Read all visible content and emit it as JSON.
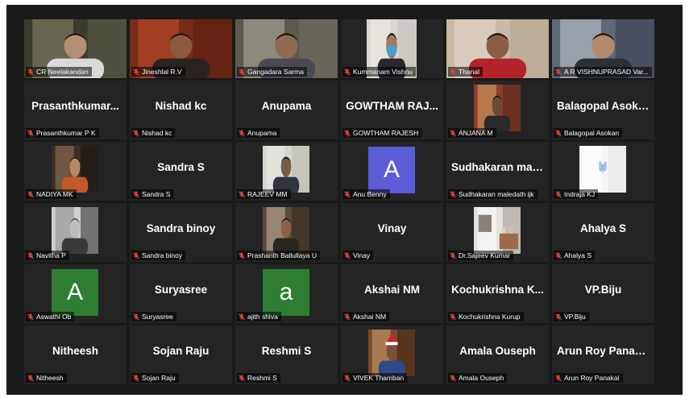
{
  "colors": {
    "background": "#1a1a1a",
    "tile": "#242424",
    "active_border": "#d4e33a",
    "muted": "#e0453c",
    "avatar_purple": "#5b5cd6",
    "avatar_green": "#2e7d32"
  },
  "participants": [
    {
      "label": "CR Neelakandan",
      "type": "video",
      "active": true
    },
    {
      "label": "Jineshlal R.V",
      "type": "video"
    },
    {
      "label": "Gangadara Sarma",
      "type": "video"
    },
    {
      "label": "Kummanam Vishnu",
      "type": "video"
    },
    {
      "label": "Thanal",
      "type": "video"
    },
    {
      "label": "A R VISHNUPRASAD Var...",
      "type": "video"
    },
    {
      "name": "Prasanthkumar...",
      "label": "Prasanthkumar P K",
      "type": "name"
    },
    {
      "name": "Nishad kc",
      "label": "Nishad kc",
      "type": "name"
    },
    {
      "name": "Anupama",
      "label": "Anupama",
      "type": "name"
    },
    {
      "name": "GOWTHAM RAJ...",
      "label": "GOWTHAM RAJESH",
      "type": "name"
    },
    {
      "label": "ANJANA M",
      "type": "photo"
    },
    {
      "name": "Balagopal Asokan",
      "label": "Balagopal Asokan",
      "type": "name"
    },
    {
      "label": "NADIYA MK",
      "type": "photo"
    },
    {
      "name": "Sandra S",
      "label": "Sandra S",
      "type": "name"
    },
    {
      "label": "RAJEEV MM",
      "type": "photo"
    },
    {
      "letter": "A",
      "label": "Anu Benny",
      "type": "avatar",
      "avatar_color": "#5b5cd6"
    },
    {
      "name": "Sudhakaran mal...",
      "label": "Sudhakaran maledath ijk",
      "type": "name"
    },
    {
      "label": "Indraja KJ",
      "type": "photo"
    },
    {
      "label": "Navitha P",
      "type": "photo"
    },
    {
      "name": "Sandra binoy",
      "label": "Sandra binoy",
      "type": "name"
    },
    {
      "label": "Prashanth Ballullaya U",
      "type": "photo"
    },
    {
      "name": "Vinay",
      "label": "Vinay",
      "type": "name"
    },
    {
      "label": "Dr.Sajeev Kumar",
      "type": "photo"
    },
    {
      "name": "Ahalya S",
      "label": "Ahalya S",
      "type": "name"
    },
    {
      "letter": "A",
      "label": "Aswathi Ob",
      "type": "avatar",
      "avatar_color": "#2e7d32"
    },
    {
      "name": "Suryasree",
      "label": "Suryasree",
      "type": "name"
    },
    {
      "letter": "a",
      "label": "ajith shiva",
      "type": "avatar",
      "avatar_color": "#2e7d32"
    },
    {
      "name": "Akshai NM",
      "label": "Akshai NM",
      "type": "name"
    },
    {
      "name": "Kochukrishna K...",
      "label": "Kochukrishna Kurup",
      "type": "name"
    },
    {
      "name": "VP.Biju",
      "label": "VP.Biju",
      "type": "name"
    },
    {
      "name": "Nitheesh",
      "label": "Nitheesh",
      "type": "name"
    },
    {
      "name": "Sojan Raju",
      "label": "Sojan Raju",
      "type": "name"
    },
    {
      "name": "Reshmi S",
      "label": "Reshmi S",
      "type": "name"
    },
    {
      "label": "VIVEK Thamban",
      "type": "photo"
    },
    {
      "name": "Amala Ouseph",
      "label": "Amala Ouseph",
      "type": "name"
    },
    {
      "name": "Arun Roy Panakal",
      "label": "Arun Roy Panakal",
      "type": "name"
    }
  ]
}
